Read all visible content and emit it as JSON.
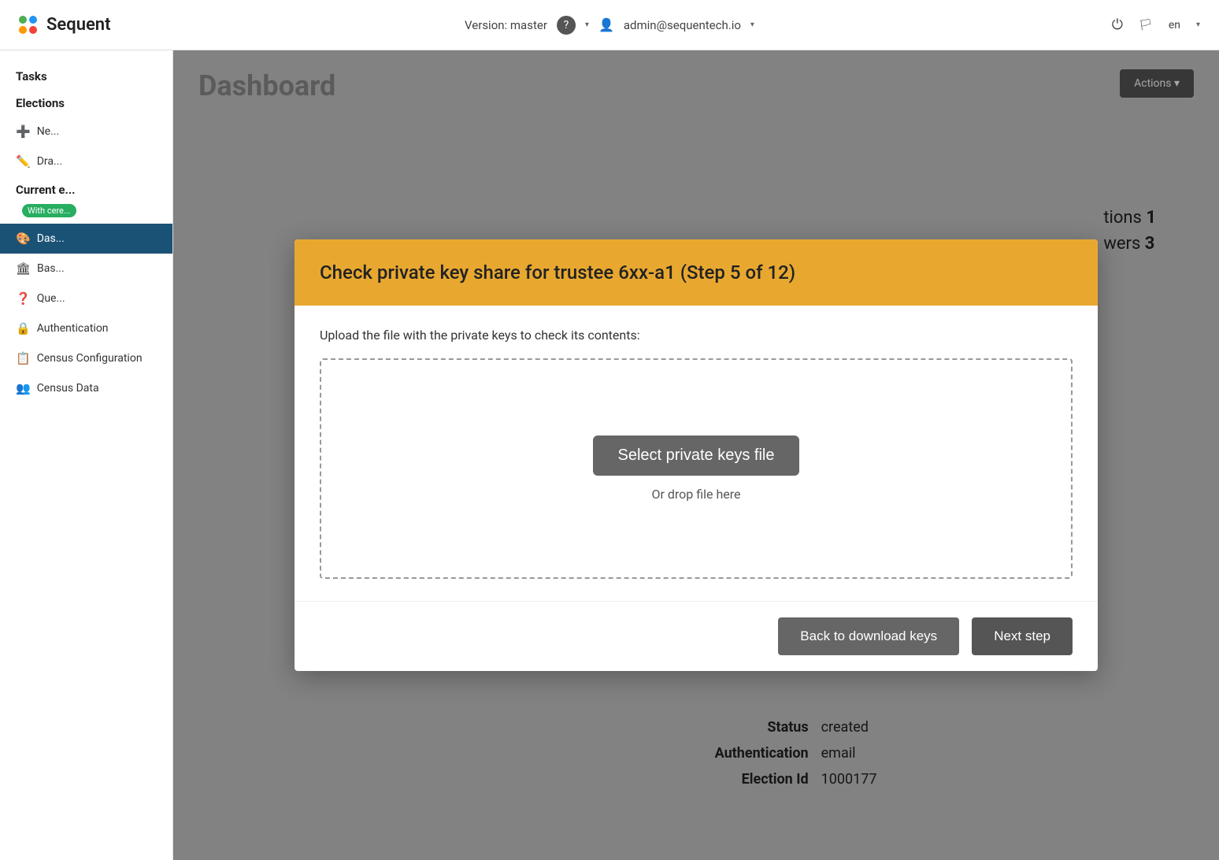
{
  "navbar": {
    "brand": "Sequent",
    "version": "Version: master",
    "help_icon": "?",
    "user": "admin@sequentech.io",
    "power_icon": "⏻",
    "lang": "en"
  },
  "sidebar": {
    "tasks_label": "Tasks",
    "elections_label": "Elections",
    "items": [
      {
        "id": "new",
        "icon": "➕",
        "label": "Ne..."
      },
      {
        "id": "drafts",
        "icon": "✏️",
        "label": "Dra..."
      },
      {
        "id": "current",
        "label": "Current e..."
      },
      {
        "id": "ceremony",
        "badge": "With cere..."
      },
      {
        "id": "dashboard",
        "icon": "🎨",
        "label": "Das...",
        "active": true
      },
      {
        "id": "basic",
        "icon": "🏛",
        "label": "Bas..."
      },
      {
        "id": "questions",
        "icon": "❓",
        "label": "Que..."
      },
      {
        "id": "authentication",
        "icon": "🔒",
        "label": "Authentication"
      },
      {
        "id": "census-config",
        "icon": "📋",
        "label": "Census Configuration"
      },
      {
        "id": "census-data",
        "icon": "👥",
        "label": "Census Data"
      }
    ]
  },
  "background": {
    "title": "Dashboard",
    "actions_label": "Actions ▾",
    "stats": {
      "questions_label": "tions",
      "questions_value": "1",
      "answers_label": "wers",
      "answers_value": "3"
    },
    "status_rows": [
      {
        "label": "Status",
        "value": "created"
      },
      {
        "label": "Authentication",
        "value": "email"
      },
      {
        "label": "Election Id",
        "value": "1000177"
      }
    ]
  },
  "modal": {
    "title": "Check private key share for trustee 6xx-a1 (Step 5 of 12)",
    "description": "Upload the file with the private keys to check its contents:",
    "select_file_btn": "Select private keys file",
    "drop_text": "Or drop file here",
    "back_btn": "Back to download keys",
    "next_btn": "Next step"
  }
}
